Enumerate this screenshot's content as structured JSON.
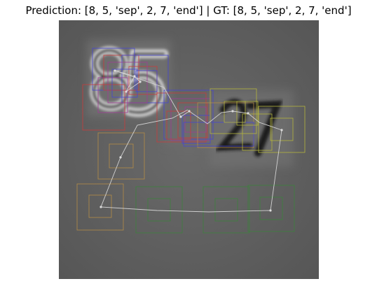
{
  "title": "Prediction: [8, 5, 'sep', 2, 7, 'end'] | GT: [8, 5, 'sep', 2, 7, 'end']",
  "image": {
    "description_icon": "grayscale-digits-image",
    "background_color": "#5f5f5f"
  },
  "colors": {
    "box_red": "#c83c3c",
    "box_blue": "#4646d2",
    "box_purple": "#a03c96",
    "box_olive": "#b4b43c",
    "box_orange": "#b48c46",
    "box_green": "#3c823c",
    "path_line": "#d2d2d2"
  }
}
